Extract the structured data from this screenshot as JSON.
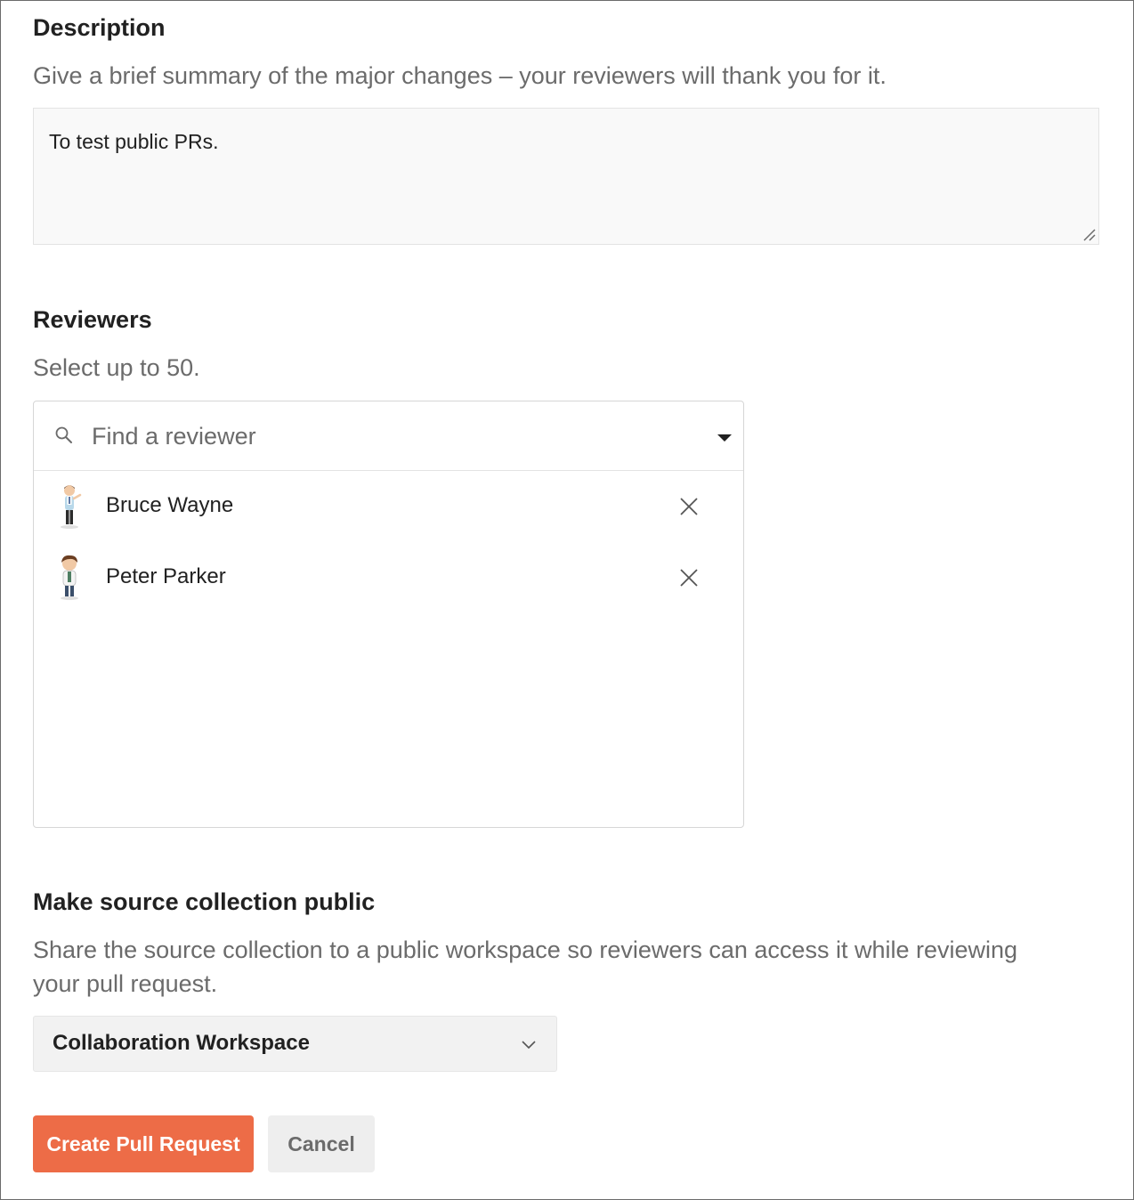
{
  "description": {
    "title": "Description",
    "helper": "Give a brief summary of the major changes – your reviewers will thank you for it.",
    "value": "To test public PRs."
  },
  "reviewers": {
    "title": "Reviewers",
    "helper": "Select up to 50.",
    "search_placeholder": "Find a reviewer",
    "search_icon": "search-icon",
    "dropdown_icon": "caret-down-icon",
    "selected": [
      {
        "name": "Bruce Wayne",
        "avatar": "avatar-illustration",
        "remove_icon": "close-icon"
      },
      {
        "name": "Peter Parker",
        "avatar": "avatar-illustration",
        "remove_icon": "close-icon"
      }
    ]
  },
  "public_collection": {
    "title": "Make source collection public",
    "helper_line1": "Share the source collection to a public workspace so reviewers can access it while reviewing",
    "helper_line2": "your pull request.",
    "workspace_selected": "Collaboration Workspace",
    "workspace_icon": "chevron-down-icon"
  },
  "actions": {
    "primary_label": "Create Pull Request",
    "secondary_label": "Cancel"
  },
  "colors": {
    "accent": "#ed6c47",
    "text": "#212121",
    "muted": "#6b6b6b",
    "input_bg": "#f9f9f9"
  }
}
